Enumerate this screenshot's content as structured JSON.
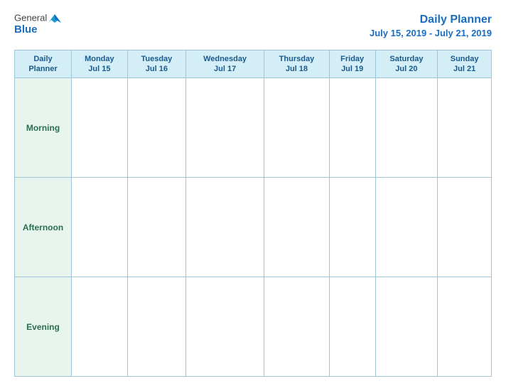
{
  "logo": {
    "general": "General",
    "blue": "Blue",
    "bird_symbol": "▶"
  },
  "title": {
    "main": "Daily Planner",
    "date_range": "July 15, 2019 - July 21, 2019"
  },
  "table": {
    "header_col1_line1": "Daily",
    "header_col1_line2": "Planner",
    "columns": [
      {
        "day": "Monday",
        "date": "Jul 15"
      },
      {
        "day": "Tuesday",
        "date": "Jul 16"
      },
      {
        "day": "Wednesday",
        "date": "Jul 17"
      },
      {
        "day": "Thursday",
        "date": "Jul 18"
      },
      {
        "day": "Friday",
        "date": "Jul 19"
      },
      {
        "day": "Saturday",
        "date": "Jul 20"
      },
      {
        "day": "Sunday",
        "date": "Jul 21"
      }
    ],
    "rows": [
      {
        "label": "Morning"
      },
      {
        "label": "Afternoon"
      },
      {
        "label": "Evening"
      }
    ]
  }
}
